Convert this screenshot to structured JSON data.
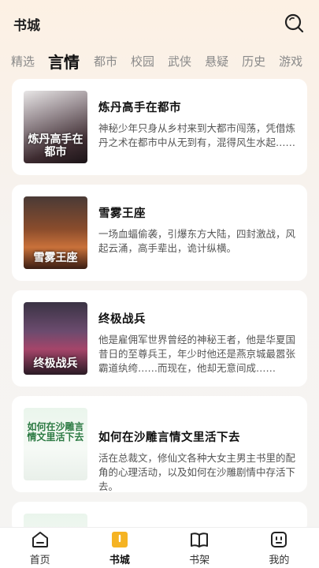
{
  "header": {
    "title": "书城"
  },
  "tabs": [
    {
      "label": "精选",
      "active": false
    },
    {
      "label": "言情",
      "active": true
    },
    {
      "label": "都市",
      "active": false
    },
    {
      "label": "校园",
      "active": false
    },
    {
      "label": "武侠",
      "active": false
    },
    {
      "label": "悬疑",
      "active": false
    },
    {
      "label": "历史",
      "active": false
    },
    {
      "label": "游戏",
      "active": false
    }
  ],
  "books": [
    {
      "title": "炼丹高手在都市",
      "description": "神秘少年只身从乡村来到大都市闯荡，凭借炼丹之术在都市中从无到有，混得风生水起……",
      "cover_text": "炼丹高手在都市"
    },
    {
      "title": "雪雾王座",
      "description": "一场血蝠偷袭，引爆东方大陆，四封激战，风起云涌，高手辈出，诡计纵横。",
      "cover_text": "雪雾王座"
    },
    {
      "title": "终极战兵",
      "description": "他是雇佣军世界曾经的神秘王者，他是华夏国昔日的至尊兵王，年少时他还是燕京城最嚣张霸道纨绔……而现在，他却无意间成……",
      "cover_text": "终极战兵"
    },
    {
      "title": "如何在沙雕言情文里活下去",
      "description": "活在总裁文，修仙文各种大女主男主书里的配角的心理活动，以及如何在沙雕剧情中存活下去。",
      "cover_text": "如何在沙雕言情文里活下去"
    }
  ],
  "bottom_nav": [
    {
      "label": "首页",
      "icon": "home-icon",
      "active": false
    },
    {
      "label": "书城",
      "icon": "bookstore-icon",
      "active": true
    },
    {
      "label": "书架",
      "icon": "bookshelf-icon",
      "active": false
    },
    {
      "label": "我的",
      "icon": "profile-icon",
      "active": false
    }
  ],
  "colors": {
    "accent": "#f5b323",
    "background": "#f5f4f3",
    "card": "#ffffff"
  }
}
